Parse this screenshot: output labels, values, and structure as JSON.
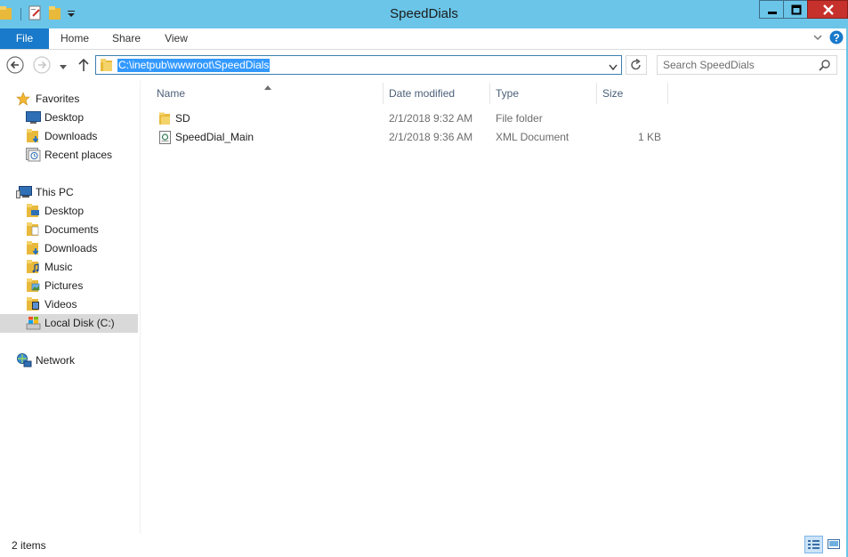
{
  "window": {
    "title": "SpeedDials"
  },
  "ribbon": {
    "tabs": [
      {
        "label": "File"
      },
      {
        "label": "Home"
      },
      {
        "label": "Share"
      },
      {
        "label": "View"
      }
    ]
  },
  "address": {
    "path": "C:\\inetpub\\wwwroot\\SpeedDials"
  },
  "search": {
    "placeholder": "Search SpeedDials"
  },
  "nav": {
    "favorites": {
      "label": "Favorites",
      "items": [
        {
          "label": "Desktop",
          "icon": "desktop-icon"
        },
        {
          "label": "Downloads",
          "icon": "downloads-folder-icon"
        },
        {
          "label": "Recent places",
          "icon": "recent-places-icon"
        }
      ]
    },
    "this_pc": {
      "label": "This PC",
      "items": [
        {
          "label": "Desktop",
          "icon": "desktop-folder-icon"
        },
        {
          "label": "Documents",
          "icon": "documents-folder-icon"
        },
        {
          "label": "Downloads",
          "icon": "downloads-folder-icon"
        },
        {
          "label": "Music",
          "icon": "music-folder-icon"
        },
        {
          "label": "Pictures",
          "icon": "pictures-folder-icon"
        },
        {
          "label": "Videos",
          "icon": "videos-folder-icon"
        },
        {
          "label": "Local Disk (C:)",
          "icon": "local-disk-icon"
        }
      ]
    },
    "network": {
      "label": "Network"
    }
  },
  "columns": [
    {
      "label": "Name"
    },
    {
      "label": "Date modified"
    },
    {
      "label": "Type"
    },
    {
      "label": "Size"
    }
  ],
  "files": [
    {
      "name": "SD",
      "date": "2/1/2018 9:32 AM",
      "type": "File folder",
      "size": "",
      "icon": "folder-icon"
    },
    {
      "name": "SpeedDial_Main",
      "date": "2/1/2018 9:36 AM",
      "type": "XML Document",
      "size": "1 KB",
      "icon": "xml-document-icon"
    }
  ],
  "status": {
    "item_count": "2 items"
  },
  "colors": {
    "titlebar": "#6bc5e8",
    "file_tab": "#1979ca",
    "selection": "#3399ff",
    "close_button": "#c7312b"
  }
}
